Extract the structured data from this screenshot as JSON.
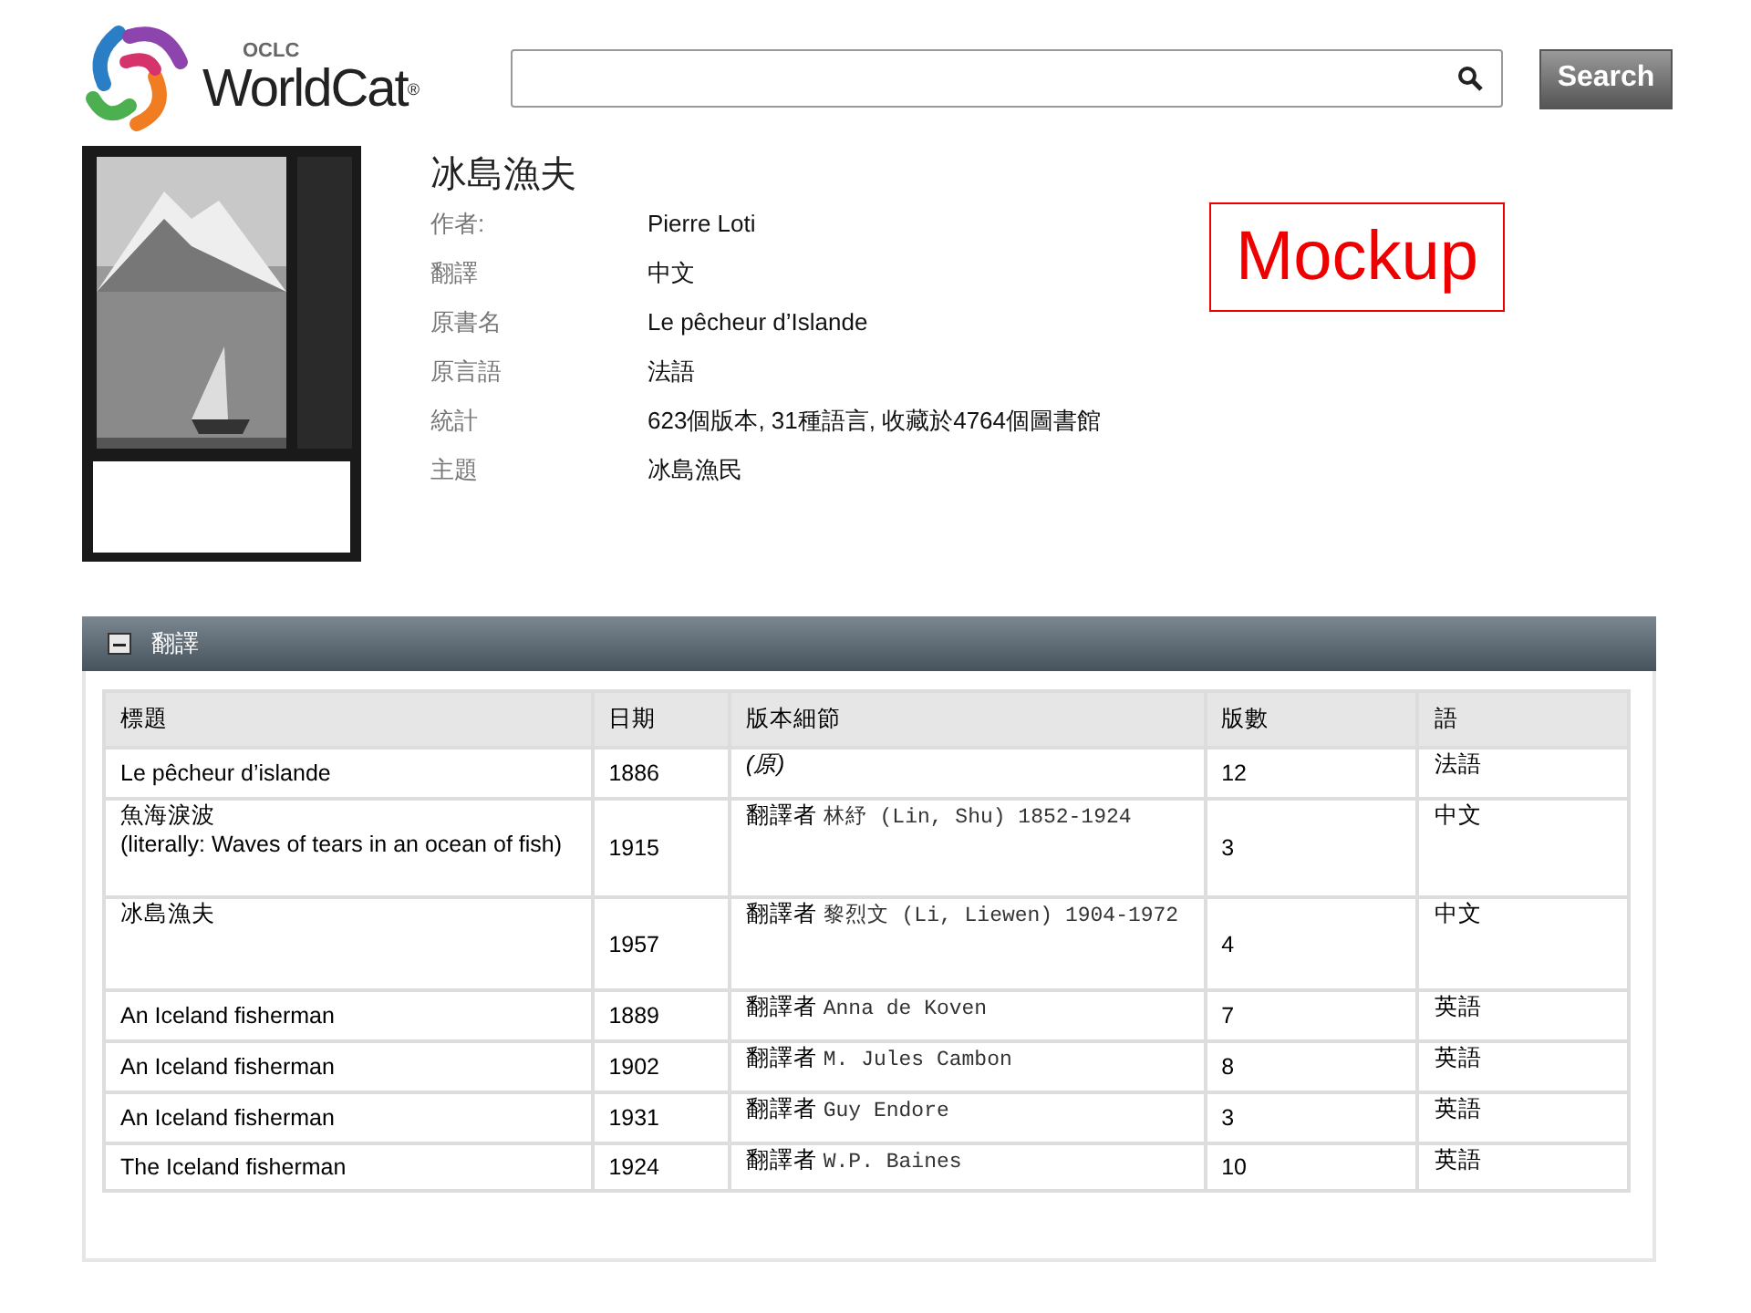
{
  "logo": {
    "small": "OCLC",
    "name": "WorldCat",
    "mark": "®"
  },
  "search": {
    "button": "Search"
  },
  "book": {
    "title": "冰島漁夫",
    "fields": [
      {
        "label": "作者:",
        "value": "Pierre Loti"
      },
      {
        "label": "翻譯",
        "value": "中文"
      },
      {
        "label": "原書名",
        "value": "Le pêcheur d’Islande"
      },
      {
        "label": "原言語",
        "value": "法語"
      },
      {
        "label": "統計",
        "value": "623個版本, 31種語言, 收藏於4764個圖書館"
      },
      {
        "label": "主題",
        "value": "冰島漁民"
      }
    ]
  },
  "stamp": "Mockup",
  "section": {
    "title": "翻譯",
    "expanded": true,
    "table": {
      "columns": [
        "標題",
        "日期",
        "版本細節",
        "版數",
        "語"
      ],
      "rows": [
        {
          "title": [
            "Le pêcheur d’islande"
          ],
          "date": "1886",
          "edition": {
            "kind": "original",
            "text": "(原)"
          },
          "count": "12",
          "language": "法語"
        },
        {
          "title": [
            "魚海淚波",
            "(literally: Waves of tears in an ocean of fish)"
          ],
          "date": "1915",
          "edition": {
            "kind": "translation",
            "label": "翻譯者",
            "text": "林紓 (Lin, Shu) 1852-1924"
          },
          "count": "3",
          "language": "中文"
        },
        {
          "title": [
            "冰島漁夫"
          ],
          "date": "1957",
          "edition": {
            "kind": "translation",
            "label": "翻譯者",
            "text": "黎烈文 (Li, Liewen) 1904-1972"
          },
          "count": "4",
          "language": "中文"
        },
        {
          "title": [
            "An Iceland fisherman"
          ],
          "date": "1889",
          "edition": {
            "kind": "translation",
            "label": "翻譯者",
            "text": "Anna de Koven"
          },
          "count": "7",
          "language": "英語"
        },
        {
          "title": [
            "An Iceland fisherman"
          ],
          "date": "1902",
          "edition": {
            "kind": "translation",
            "label": "翻譯者",
            "text": "M. Jules Cambon"
          },
          "count": "8",
          "language": "英語"
        },
        {
          "title": [
            "An Iceland fisherman"
          ],
          "date": "1931",
          "edition": {
            "kind": "translation",
            "label": "翻譯者",
            "text": "Guy Endore"
          },
          "count": "3",
          "language": "英語"
        },
        {
          "title": [
            "The Iceland fisherman"
          ],
          "date": "1924",
          "edition": {
            "kind": "translation",
            "label": "翻譯者",
            "text": "W.P. Baines"
          },
          "count": "10",
          "language": "英語"
        }
      ]
    }
  }
}
